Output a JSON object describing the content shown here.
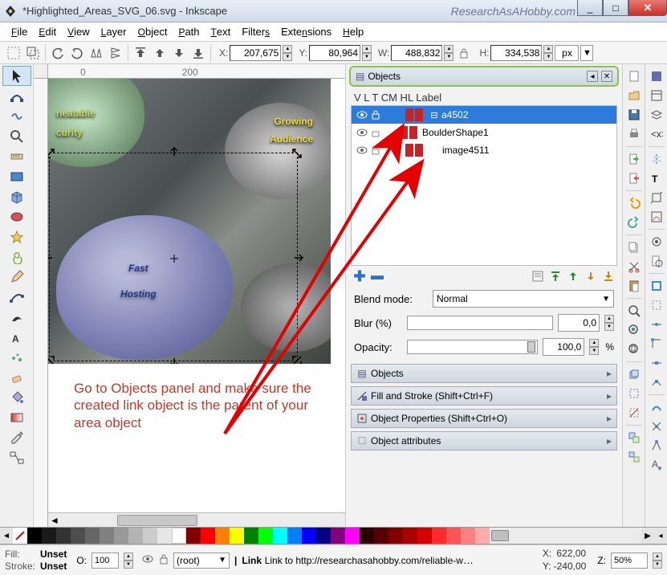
{
  "window": {
    "app": "Inkscape",
    "title": "*Highlighted_Areas_SVG_06.svg - Inkscape",
    "research": "ResearchAsAHobby.com",
    "min": "_",
    "max": "□",
    "close": "✕"
  },
  "menu": [
    "File",
    "Edit",
    "View",
    "Layer",
    "Object",
    "Path",
    "Text",
    "Filters",
    "Extensions",
    "Help"
  ],
  "coords": {
    "x_lbl": "X:",
    "x": "207,675",
    "y_lbl": "Y:",
    "y": "80,964",
    "w_lbl": "W:",
    "w": "488,832",
    "h_lbl": "H:",
    "h": "334,538",
    "unit": "px"
  },
  "canvas_text": {
    "unbeat1": "neatable",
    "unbeat2": "curity",
    "grow1": "Growing",
    "grow2": "Audience",
    "fast1": "Fast",
    "fast2": "Hosting"
  },
  "annotation": "Go to Objects panel and make sure the created link object is the parent of your area object",
  "objects": {
    "title": "Objects",
    "cols": "V  L  T   CM HL Label",
    "rows": [
      {
        "label": "a4502",
        "sel": true,
        "expand": "⊟"
      },
      {
        "label": "BoulderShape1",
        "sel": false,
        "child": true
      },
      {
        "label": "image4511",
        "sel": false,
        "child": false
      }
    ],
    "blend_lbl": "Blend mode:",
    "blend": "Normal",
    "blur_lbl": "Blur (%)",
    "blur": "0,0",
    "opacity_lbl": "Opacity:",
    "opacity": "100,0"
  },
  "panels": {
    "p1": "Objects",
    "p2": "Fill and Stroke (Shift+Ctrl+F)",
    "p3": "Object Properties (Shift+Ctrl+O)",
    "p4": "Object attributes"
  },
  "status": {
    "fill_lbl": "Fill:",
    "fill": "Unset",
    "stroke_lbl": "Stroke:",
    "stroke": "Unset",
    "o_lbl": "O:",
    "o": "100",
    "layer": "(root)",
    "link": "Link to http://researchasahobby.com/reliable-web-...",
    "xy": "X:",
    "xyv": "622,00",
    "y": "Y:",
    "yv": "-240,00",
    "z_lbl": "Z:",
    "z": "50%"
  }
}
